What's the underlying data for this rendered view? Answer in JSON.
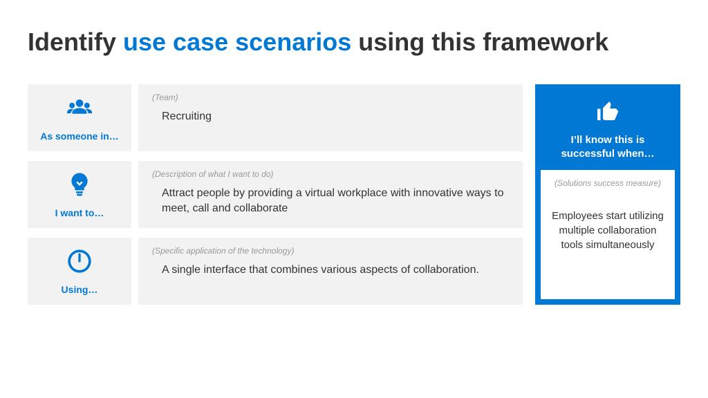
{
  "title": {
    "pre": "Identify ",
    "accent": "use case scenarios",
    "post": " using this framework"
  },
  "rows": [
    {
      "label": "As someone in…",
      "hint": "(Team)",
      "body": "Recruiting"
    },
    {
      "label": "I want to…",
      "hint": "(Description of what I want to do)",
      "body": "Attract people by providing a virtual workplace with innovative ways to meet, call and collaborate"
    },
    {
      "label": "Using…",
      "hint": "(Specific application of the technology)",
      "body": "A single interface that combines various aspects of collaboration."
    }
  ],
  "success": {
    "title": "I’ll know this is successful when…",
    "hint": "(Solutions success measure)",
    "body": "Employees start utilizing multiple collaboration tools simultaneously"
  }
}
